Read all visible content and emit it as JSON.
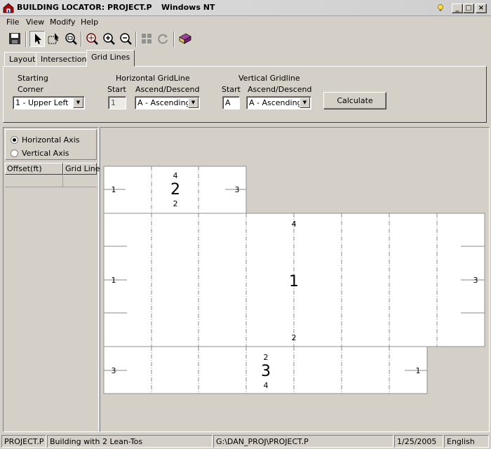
{
  "window": {
    "title": "BUILDING LOCATOR: PROJECT.P",
    "os_label": "Windows NT",
    "controls": {
      "minimize": "_",
      "maximize": "□",
      "close": "×"
    }
  },
  "menu": {
    "items": [
      "File",
      "View",
      "Modify",
      "Help"
    ]
  },
  "toolbar": {
    "icons": [
      "save-icon",
      "pointer-icon",
      "select-region-icon",
      "zoom-window-icon",
      "zoom-extents-icon",
      "zoom-in-icon",
      "zoom-out-icon",
      "grid-icon",
      "refresh-icon",
      "book-icon"
    ]
  },
  "tabs": [
    "Layout",
    "Intersections",
    "Grid Lines"
  ],
  "active_tab": "Grid Lines",
  "grid_lines": {
    "starting_label": "Starting",
    "corner_label": "Corner",
    "corner_value": "1 - Upper Left",
    "horizontal_title": "Horizontal GridLine",
    "horizontal_start_label": "Start",
    "horizontal_order_label": "Ascend/Descend",
    "horizontal_start_value": "1",
    "horizontal_order_value": "A - Ascending",
    "vertical_title": "Vertical Gridline",
    "vertical_start_label": "Start",
    "vertical_order_label": "Ascend/Descend",
    "vertical_start_value": "A",
    "vertical_order_value": "A - Ascending",
    "calculate_label": "Calculate"
  },
  "axis": {
    "horizontal_label": "Horizontal Axis",
    "vertical_label": "Vertical Axis",
    "selected": "horizontal"
  },
  "offset_table": {
    "columns": [
      "Offset(ft)",
      "Grid Line"
    ],
    "rows": []
  },
  "drawing": {
    "buildings": [
      {
        "label": "2",
        "top_label": "4",
        "bottom_label": "2",
        "left_label": "1",
        "right_label": "3"
      },
      {
        "label": "1",
        "top_label": "4",
        "bottom_label": "2",
        "left_label": "1",
        "right_label": "3"
      },
      {
        "label": "3",
        "top_label": "2",
        "bottom_label": "4",
        "left_label": "3",
        "right_label": "1"
      }
    ]
  },
  "status": {
    "file": "PROJECT.P",
    "description": "Building with 2 Lean-Tos",
    "path": "G:\\DAN_PROJ\\PROJECT.P",
    "date": "1/25/2005",
    "language": "English"
  },
  "colors": {
    "face": "#d4d0c8",
    "canvas_bg": "#d4d0c8",
    "building_fill": "#ffffff"
  }
}
